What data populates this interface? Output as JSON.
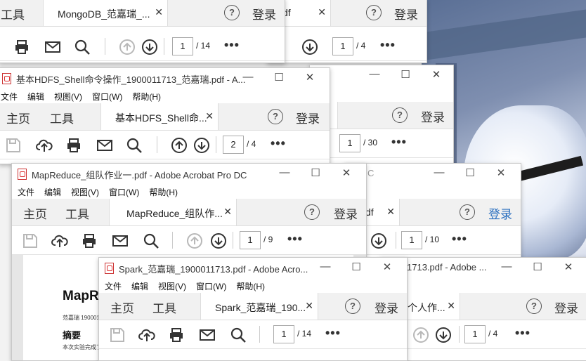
{
  "windows": {
    "w_back_top": {
      "tabs": {
        "tools": "工具",
        "doc": "MongoDB_范嘉瑞_..."
      },
      "login": "登录",
      "page": {
        "current": "1",
        "total": "/ 14"
      }
    },
    "w_back_top_right": {
      "tabs": {
        "doc": "df"
      },
      "login": "登录",
      "page": {
        "current": "1",
        "total": "/ 4"
      }
    },
    "w_hdfs": {
      "title": "基本HDFS_Shell命令操作_1900011713_范嘉瑞.pdf - A...",
      "menu": [
        "文件",
        "编辑",
        "视图(V)",
        "窗口(W)",
        "帮助(H)"
      ],
      "tabs": {
        "home": "主页",
        "tools": "工具",
        "doc": "基本HDFS_Shell命..."
      },
      "login": "登录",
      "page": {
        "current": "2",
        "total": "/ 4"
      }
    },
    "w_back_mid": {
      "login": "登录",
      "page": {
        "current": "1",
        "total": "/ 30"
      }
    },
    "w_mapreduce": {
      "title": "MapReduce_组队作业一.pdf - Adobe Acrobat Pro DC",
      "menu": [
        "文件",
        "编辑",
        "视图(V)",
        "窗口(W)",
        "帮助(H)"
      ],
      "tabs": {
        "home": "主页",
        "tools": "工具",
        "doc": "MapReduce_组队作..."
      },
      "login": "登录",
      "page": {
        "current": "1",
        "total": "/ 9"
      },
      "doc": {
        "heading": "MapRe",
        "author": "范嘉瑞 1900011",
        "section": "摘要",
        "text": "本次实验完成了"
      }
    },
    "w_back_right": {
      "title_suffix": "C",
      "tabs": {
        "doc": "df"
      },
      "login": "登录",
      "page": {
        "current": "1",
        "total": "/ 10"
      }
    },
    "w_spark": {
      "title": "Spark_范嘉瑞_1900011713.pdf - Adobe Acro...",
      "menu": [
        "文件",
        "编辑",
        "视图(V)",
        "窗口(W)",
        "帮助(H)"
      ],
      "tabs": {
        "home": "主页",
        "tools": "工具",
        "doc": "Spark_范嘉瑞_190..."
      },
      "login": "登录",
      "page": {
        "current": "1",
        "total": "/ 14"
      }
    },
    "w_personal": {
      "title": "1713.pdf - Adobe ...",
      "tabs": {
        "doc": "个人作..."
      },
      "login": "登录",
      "page": {
        "current": "1",
        "total": "/ 4"
      }
    }
  },
  "colors": {
    "accent": "#2a6fbf",
    "disabled": "#b8b8b8"
  }
}
